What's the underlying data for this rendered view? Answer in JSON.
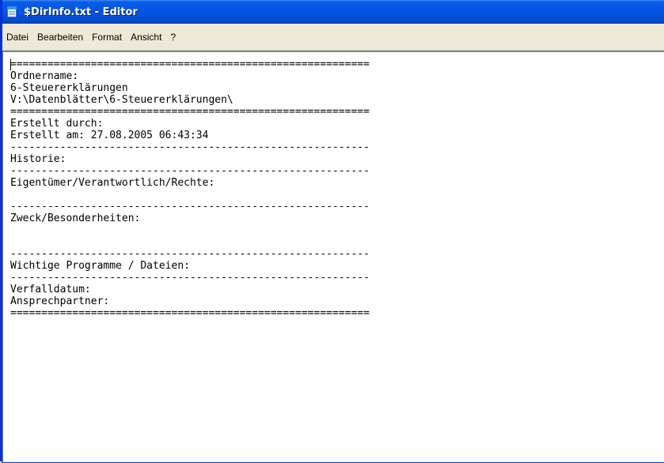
{
  "window": {
    "title": "$DirInfo.txt - Editor",
    "app_icon": "notepad-icon"
  },
  "menubar": {
    "items": [
      {
        "label": "Datei"
      },
      {
        "label": "Bearbeiten"
      },
      {
        "label": "Format"
      },
      {
        "label": "Ansicht"
      },
      {
        "label": "?"
      }
    ]
  },
  "editor": {
    "lines": [
      "==========================================================",
      "Ordnername:",
      "6-Steuererklärungen",
      "V:\\Datenblätter\\6-Steuererklärungen\\",
      "==========================================================",
      "Erstellt durch:",
      "Erstellt am: 27.08.2005 06:43:34",
      "----------------------------------------------------------",
      "Historie:",
      "----------------------------------------------------------",
      "Eigentümer/Verantwortlich/Rechte:",
      "",
      "----------------------------------------------------------",
      "Zweck/Besonderheiten:",
      "",
      "",
      "----------------------------------------------------------",
      "Wichtige Programme / Dateien:",
      "----------------------------------------------------------",
      "Verfalldatum:",
      "Ansprechpartner:",
      "=========================================================="
    ]
  }
}
